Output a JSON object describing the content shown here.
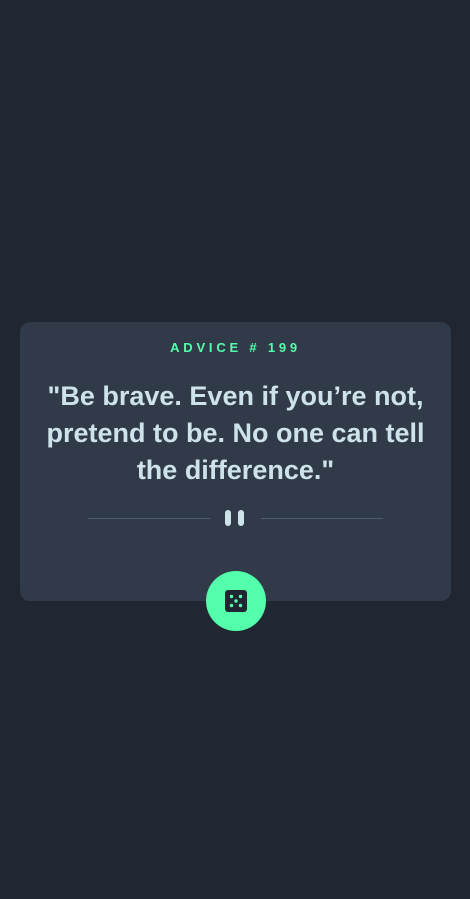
{
  "advice": {
    "label": "ADVICE # 199",
    "text": "\"Be brave. Even if you’re not, pretend to be. No one can tell the difference.\""
  },
  "icons": {
    "divider": "pause-icon",
    "button": "dice-icon"
  },
  "colors": {
    "background": "#202632",
    "card": "#313a48",
    "accent": "#53ffaa",
    "text": "#cee3e9",
    "divider_line": "#4f5d74"
  }
}
